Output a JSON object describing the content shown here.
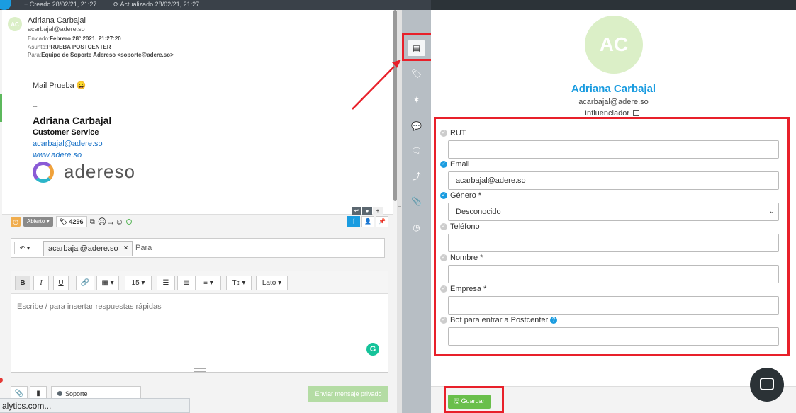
{
  "topbar": {
    "created": "+ Creado  28/02/21, 21:27",
    "updated": "⟳ Actualizado  28/02/21, 21:27"
  },
  "mail": {
    "avatar_initials": "AC",
    "from_name": "Adriana Carbajal",
    "from_email": "acarbajal@adere.so",
    "sent_label": "Enviado:",
    "sent_value": "Febrero 28° 2021, 21:27:20",
    "subject_label": "Asunto:",
    "subject_value": "PRUEBA POSTCENTER",
    "to_label": "Para:",
    "to_value": "Equipo de Soporte Adereso <soporte@adere.so>",
    "body": "Mail Prueba 😀",
    "sig_sep": "--",
    "sig_name": "Adriana Carbajal",
    "sig_role": "Customer Service",
    "sig_email": "acarbajal@adere.so",
    "sig_web": "www.adere.so",
    "logo_text": "adereso"
  },
  "composer": {
    "status": "Abierto ▾",
    "ticket_id": "4296",
    "faces": "☹→☺",
    "recipient": "acarbajal@adere.so",
    "to_placeholder": "Para",
    "font_size": "15 ▾",
    "font_family": "Lato ▾",
    "placeholder": "Escribe / para insertar respuestas rápidas",
    "team": "Soporte",
    "send_private": "Enviar mensaje privado"
  },
  "status_url": "alytics.com...",
  "contact": {
    "initials": "AC",
    "name": "Adriana Carbajal",
    "email": "acarbajal@adere.so",
    "influencer": "Influenciador"
  },
  "form": {
    "rut_label": "RUT",
    "email_label": "Email",
    "email_value": "acarbajal@adere.so",
    "gender_label": "Género *",
    "gender_value": "Desconocido",
    "phone_label": "Teléfono",
    "name_label": "Nombre *",
    "company_label": "Empresa *",
    "bot_label": "Bot para entrar a Postcenter"
  },
  "save_label": "Guardar",
  "colors": {
    "accent": "#1a9ce0",
    "highlight": "#e8202a",
    "save": "#6abf4b",
    "avatar": "#dbefc7"
  }
}
